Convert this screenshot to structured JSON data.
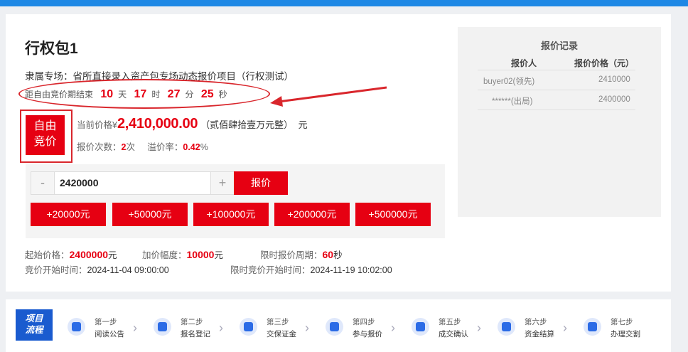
{
  "header": {
    "title": "行权包1",
    "subtitle": "隶属专场：省所直接录入资产包专场动态报价项目（行权测试）"
  },
  "countdown": {
    "prefix": "距自由竞价期结束",
    "days": "10",
    "days_unit": "天",
    "hours": "17",
    "hours_unit": "时",
    "minutes": "27",
    "minutes_unit": "分",
    "seconds": "25",
    "seconds_unit": "秒"
  },
  "mode_badge": {
    "line1": "自由",
    "line2": "竞价"
  },
  "current": {
    "label": "当前价格",
    "currency": "¥",
    "price": "2,410,000.00",
    "price_cn": "（贰佰肆拾壹万元整）",
    "unit": "元",
    "bid_count_label": "报价次数：",
    "bid_count": "2",
    "bid_count_unit": "次",
    "premium_label": "溢价率：",
    "premium": "0.42",
    "premium_unit": "%"
  },
  "bid_form": {
    "minus": "-",
    "value": "2420000",
    "plus": "+",
    "submit": "报价",
    "increments": [
      "+20000元",
      "+50000元",
      "+100000元",
      "+200000元",
      "+500000元"
    ]
  },
  "info": {
    "start_price_label": "起始价格：",
    "start_price": "2400000",
    "start_price_unit": "元",
    "step_label": "加价幅度：",
    "step": "10000",
    "step_unit": "元",
    "period_label": "限时报价周期：",
    "period": "60",
    "period_unit": "秒",
    "start_time_label": "竞价开始时间：",
    "start_time": "2024-11-04 09:00:00",
    "limit_start_label": "限时竞价开始时间：",
    "limit_start": "2024-11-19 10:02:00"
  },
  "records": {
    "title": "报价记录",
    "col_bidder": "报价人",
    "col_price": "报价价格（元）",
    "rows": [
      {
        "bidder": "buyer02(领先)",
        "price": "2410000"
      },
      {
        "bidder": "******(出局)",
        "price": "2400000"
      }
    ]
  },
  "flow": {
    "tag_line1": "项目",
    "tag_line2": "流程",
    "steps": [
      {
        "num": "第一步",
        "name": "阅读公告",
        "icon": "document-search-icon"
      },
      {
        "num": "第二步",
        "name": "报名登记",
        "icon": "edit-form-icon"
      },
      {
        "num": "第三步",
        "name": "交保证金",
        "icon": "shield-yen-icon"
      },
      {
        "num": "第四步",
        "name": "参与报价",
        "icon": "gavel-icon"
      },
      {
        "num": "第五步",
        "name": "成交确认",
        "icon": "check-circle-icon"
      },
      {
        "num": "第六步",
        "name": "资金结算",
        "icon": "location-pin-icon"
      },
      {
        "num": "第七步",
        "name": "办理交割",
        "icon": "scales-icon"
      }
    ]
  },
  "colors": {
    "accent": "#e60012",
    "topbar": "#1e88e5",
    "flow_tag": "#1a5bcf"
  }
}
